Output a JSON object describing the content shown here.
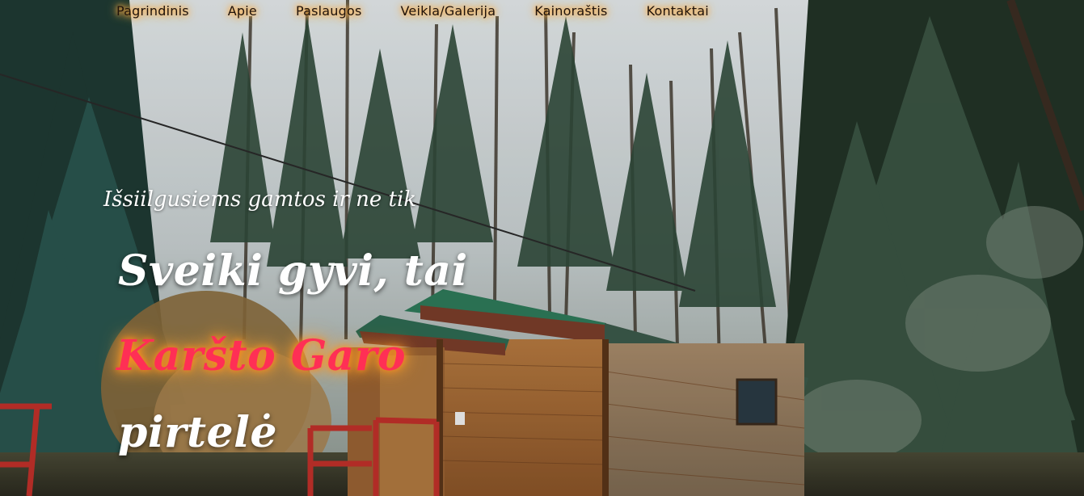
{
  "nav": {
    "items": [
      {
        "label": "Pagrindinis"
      },
      {
        "label": "Apie"
      },
      {
        "label": "Paslaugos"
      },
      {
        "label": "Veikla/Galerija"
      },
      {
        "label": "Kainoraštis"
      },
      {
        "label": "Kontaktai"
      }
    ]
  },
  "hero": {
    "tagline": "Išsiilgusiems gamtos ir ne tik",
    "headline_line1": "Sveiki gyvi, tai",
    "headline_line2": "Karšto Garo",
    "headline_line3": "pirtelė",
    "background_image": "forest-cabin-photo"
  },
  "colors": {
    "nav_text": "#1f120a",
    "nav_glow": "#ffb347",
    "headline_white": "#ffffff",
    "headline_accent": "#ff2f55",
    "accent_glow": "#ff8a1a"
  }
}
